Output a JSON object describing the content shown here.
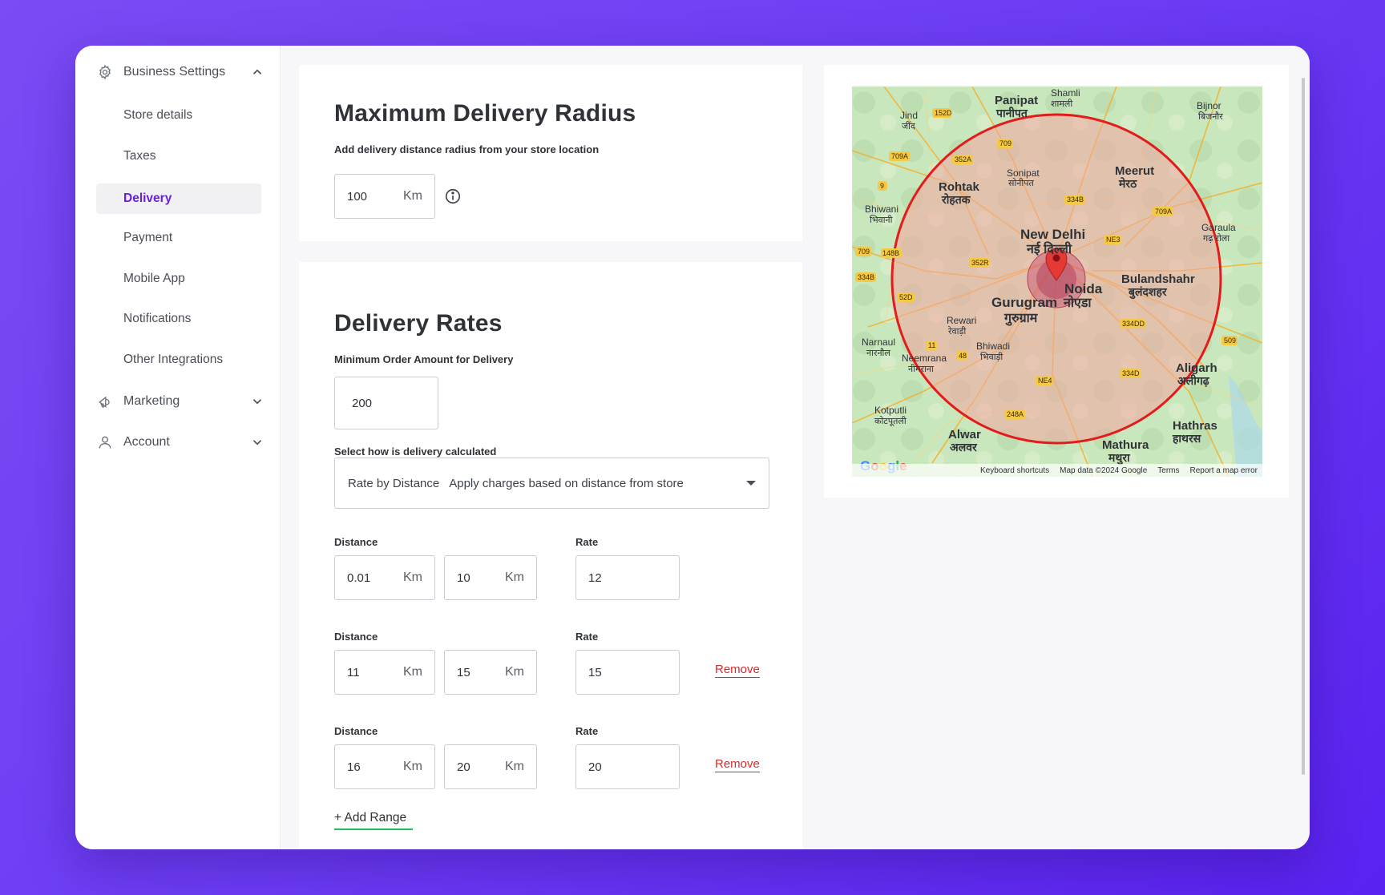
{
  "sidebar": {
    "business_settings": "Business Settings",
    "items": [
      {
        "label": "Store details"
      },
      {
        "label": "Taxes"
      },
      {
        "label": "Delivery"
      },
      {
        "label": "Payment"
      },
      {
        "label": "Mobile App"
      },
      {
        "label": "Notifications"
      },
      {
        "label": "Other Integrations"
      }
    ],
    "marketing": "Marketing",
    "account": "Account"
  },
  "radius": {
    "title": "Maximum Delivery Radius",
    "subtitle": "Add delivery distance radius from your store location",
    "value": "100",
    "unit": "Km"
  },
  "rates": {
    "title": "Delivery Rates",
    "min_order_label": "Minimum Order Amount for Delivery",
    "min_order_value": "200",
    "calc_label": "Select how is delivery calculated",
    "calc_selected_title": "Rate by Distance",
    "calc_selected_desc": "Apply charges based on distance from store",
    "distance_label": "Distance",
    "rate_label": "Rate",
    "unit": "Km",
    "remove_label": "Remove",
    "add_range_label": "+ Add Range",
    "ranges": [
      {
        "from": "0.01",
        "to": "10",
        "rate": "12"
      },
      {
        "from": "11",
        "to": "15",
        "rate": "15"
      },
      {
        "from": "16",
        "to": "20",
        "rate": "20"
      }
    ]
  },
  "map": {
    "cities": [
      {
        "name": "Panipat",
        "local": "पानीपत"
      },
      {
        "name": "Shamli",
        "local": "शामली"
      },
      {
        "name": "Jind",
        "local": "जींद"
      },
      {
        "name": "Sonipat",
        "local": "सोनीपत"
      },
      {
        "name": "Rohtak",
        "local": "रोहतक"
      },
      {
        "name": "Meerut",
        "local": "मेरठ"
      },
      {
        "name": "Bijnor",
        "local": "बिजनौर"
      },
      {
        "name": "Bhiwani",
        "local": "भिवानी"
      },
      {
        "name": "New Delhi",
        "local": "नई दिल्ली"
      },
      {
        "name": "Garaula",
        "local": "गढ़ रोला"
      },
      {
        "name": "Noida",
        "local": "नोएडा"
      },
      {
        "name": "Bulandshahr",
        "local": "बुलंदशहर"
      },
      {
        "name": "Gurugram",
        "local": "गुरुग्राम"
      },
      {
        "name": "Rewari",
        "local": "रेवाड़ी"
      },
      {
        "name": "Narnaul",
        "local": "नारनौल"
      },
      {
        "name": "Neemrana",
        "local": "नीमराना"
      },
      {
        "name": "Bhiwadi",
        "local": "भिवाड़ी"
      },
      {
        "name": "Aligarh",
        "local": "अलीगढ़"
      },
      {
        "name": "Kotputli",
        "local": "कोटपूतली"
      },
      {
        "name": "Alwar",
        "local": "अलवर"
      },
      {
        "name": "Hathras",
        "local": "हाथरस"
      },
      {
        "name": "Mathura",
        "local": "मथुरा"
      }
    ],
    "highways": [
      "152D",
      "709",
      "352A",
      "709A",
      "9",
      "334B",
      "709A",
      "NE3",
      "352R",
      "148B",
      "709",
      "334B",
      "52D",
      "334DD",
      "11",
      "48",
      "509",
      "NE4",
      "334D",
      "248A"
    ],
    "google": "Google",
    "footer": [
      "Keyboard shortcuts",
      "Map data ©2024 Google",
      "Terms",
      "Report a map error"
    ],
    "colors": {
      "circle": "#e31b1b",
      "fill": "#f4a6a0",
      "pin": "#e53935"
    }
  }
}
